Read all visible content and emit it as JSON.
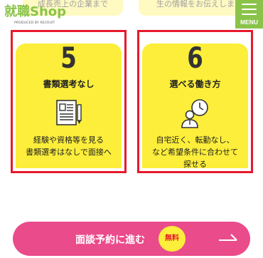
{
  "header": {
    "prev_card_left_text": "成長売上の企業まで",
    "prev_card_right_text": "生の情報をお伝えしま",
    "logo_text": "就職Shop",
    "logo_sub": "PRODUCED BY RECRUIT",
    "menu_label": "MENU"
  },
  "features": [
    {
      "number": "5",
      "title": "書類選考なし",
      "icon": "document-with-pen-icon",
      "description": "経験や資格等を見る\n書類選考はなしで面接へ"
    },
    {
      "number": "6",
      "title": "選べる働き方",
      "icon": "person-with-clock-icon",
      "description": "自宅近く、転勤なし、\nなど希望条件に合わせて\n探せる"
    }
  ],
  "cta": {
    "label": "面談予約に進む",
    "badge": "無料",
    "arrow_icon": "long-right-arrow-icon"
  },
  "colors": {
    "brand_green": "#8bc34a",
    "card_yellow": "#fcee3a",
    "highlight_red": "#e8192c",
    "cta_pink": "#ea4b8b"
  }
}
